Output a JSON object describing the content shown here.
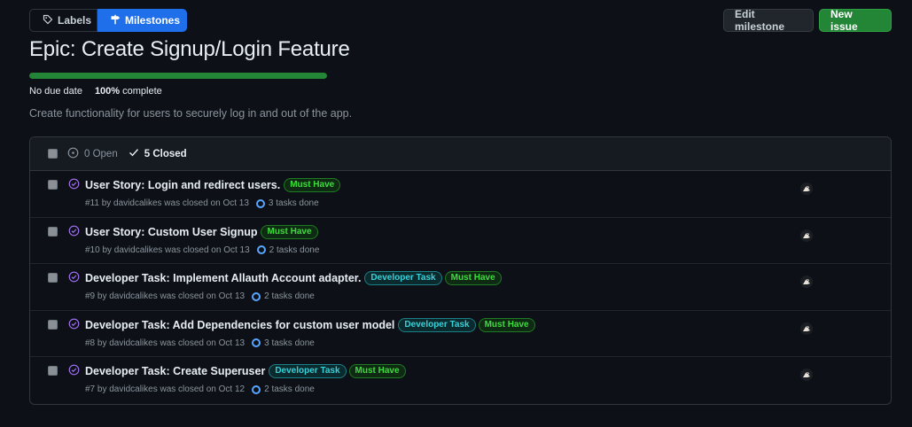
{
  "tabs": {
    "labels": "Labels",
    "milestones": "Milestones"
  },
  "actions": {
    "edit": "Edit milestone",
    "new_issue": "New issue"
  },
  "milestone": {
    "title": "Epic: Create Signup/Login Feature",
    "progress_percent": 100,
    "due": "No due date",
    "complete_value": "100%",
    "complete_label": "complete",
    "description": "Create functionality for users to securely log in and out of the app."
  },
  "list_header": {
    "open": "0 Open",
    "closed": "5 Closed"
  },
  "issues": [
    {
      "title": "User Story: Login and redirect users.",
      "labels": [
        "Must Have"
      ],
      "meta": "#11 by davidcalikes was closed on Oct 13",
      "tasks": "3 tasks done"
    },
    {
      "title": "User Story: Custom User Signup",
      "labels": [
        "Must Have"
      ],
      "meta": "#10 by davidcalikes was closed on Oct 13",
      "tasks": "2 tasks done"
    },
    {
      "title": "Developer Task: Implement Allauth Account adapter.",
      "labels": [
        "Developer Task",
        "Must Have"
      ],
      "meta": "#9 by davidcalikes was closed on Oct 13",
      "tasks": "2 tasks done"
    },
    {
      "title": "Developer Task: Add Dependencies for custom user model",
      "labels": [
        "Developer Task",
        "Must Have"
      ],
      "meta": "#8 by davidcalikes was closed on Oct 13",
      "tasks": "3 tasks done"
    },
    {
      "title": "Developer Task: Create Superuser",
      "labels": [
        "Developer Task",
        "Must Have"
      ],
      "meta": "#7 by davidcalikes was closed on Oct 12",
      "tasks": "2 tasks done"
    }
  ],
  "colors": {
    "background": "#0d1117",
    "accent_blue": "#1f6feb",
    "success_green": "#238636",
    "closed_purple": "#a371f7",
    "must_have": "#3fdc3f",
    "developer_task": "#39d0d8"
  },
  "icons": {
    "labels_tab": "tag-icon",
    "milestones_tab": "milestone-icon",
    "open_state": "issue-open-icon",
    "closed_state": "check-icon",
    "issue_status": "issue-closed-icon",
    "task_progress": "progress-ring-icon"
  }
}
